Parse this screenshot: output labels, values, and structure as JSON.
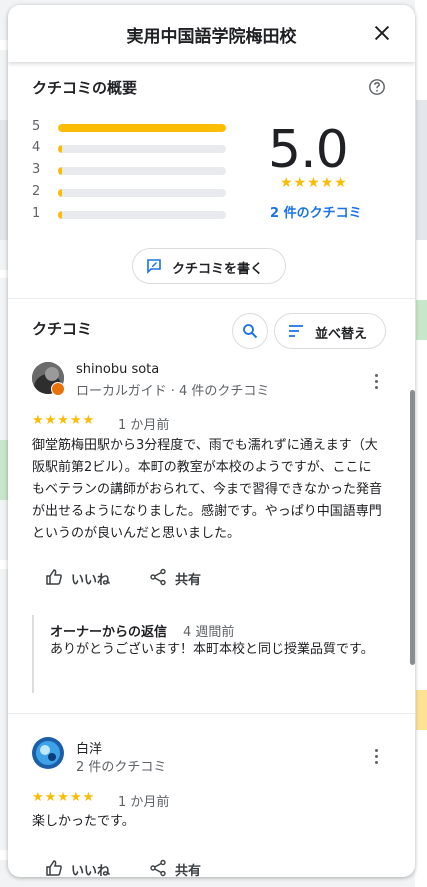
{
  "header": {
    "title": "実用中国語学院梅田校",
    "close_icon": "close-icon"
  },
  "summary": {
    "title": "クチコミの概要",
    "help_icon": "help-icon",
    "distribution": [
      {
        "stars": "5",
        "fraction": 1.0
      },
      {
        "stars": "4",
        "fraction": 0.0
      },
      {
        "stars": "3",
        "fraction": 0.0
      },
      {
        "stars": "2",
        "fraction": 0.0
      },
      {
        "stars": "1",
        "fraction": 0.0
      }
    ],
    "rating": "5.0",
    "stars": "★★★★★",
    "count_link": "2 件のクチコミ",
    "write_label": "クチコミを書く"
  },
  "reviews_section": {
    "title": "クチコミ",
    "sort_label": "並べ替え"
  },
  "reviews": [
    {
      "name": "shinobu sota",
      "sub": "ローカルガイド · 4 件のクチコミ",
      "stars": "★★★★★",
      "time": "1 か月前",
      "text": "御堂筋梅田駅から3分程度で、雨でも濡れずに通えます（大阪駅前第2ビル）。本町の教室が本校のようですが、ここにもベテランの講師がおられて、今まで習得できなかった発音が出せるようになりました。感謝です。やっぱり中国語専門というのが良いんだと思いました。",
      "like_label": "いいね",
      "share_label": "共有",
      "owner_reply": {
        "title": "オーナーからの返信",
        "time": "4 週間前",
        "text": "ありがとうございます！本町本校と同じ授業品質です。"
      }
    },
    {
      "name": "白洋",
      "sub": "2 件のクチコミ",
      "stars": "★★★★★",
      "time": "1 か月前",
      "text": "楽しかったです。",
      "like_label": "いいね",
      "share_label": "共有"
    }
  ],
  "colors": {
    "accent": "#1a73e8",
    "star": "#fbbc04",
    "guide_badge": "#e8710a"
  }
}
